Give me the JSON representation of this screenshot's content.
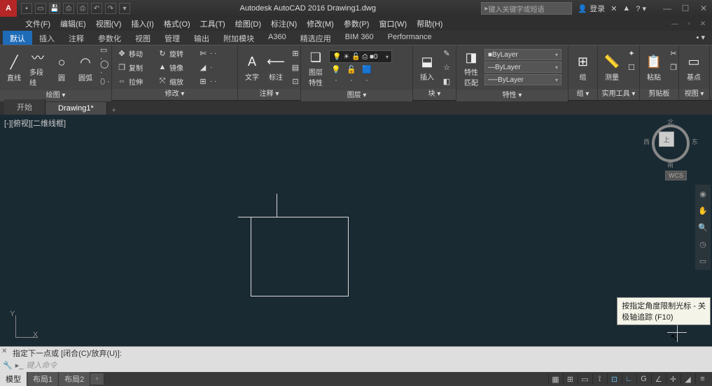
{
  "title": "Autodesk AutoCAD 2016   Drawing1.dwg",
  "search_placeholder": "键入关键字或短语",
  "login_text": "登录",
  "menus": [
    "文件(F)",
    "编辑(E)",
    "视图(V)",
    "插入(I)",
    "格式(O)",
    "工具(T)",
    "绘图(D)",
    "标注(N)",
    "修改(M)",
    "参数(P)",
    "窗口(W)",
    "帮助(H)"
  ],
  "ribbon_tabs": [
    "默认",
    "插入",
    "注释",
    "参数化",
    "视图",
    "管理",
    "输出",
    "附加模块",
    "A360",
    "精选应用",
    "BIM 360",
    "Performance"
  ],
  "ribbon_active": 0,
  "panels": {
    "draw": {
      "title": "绘图 ▾",
      "big": [
        {
          "icon": "╱",
          "label": "直线"
        },
        {
          "icon": "〰",
          "label": "多段线"
        },
        {
          "icon": "○",
          "label": "圆"
        },
        {
          "icon": "◠",
          "label": "圆弧"
        }
      ],
      "small": [
        "▭ ·",
        "◯ ·",
        "⬯ ·"
      ]
    },
    "modify": {
      "title": "修改 ▾",
      "rows": [
        [
          {
            "i": "✥",
            "t": "移动"
          },
          {
            "i": "↻",
            "t": "旋转"
          },
          {
            "i": "✄",
            "t": "· ·"
          }
        ],
        [
          {
            "i": "❐",
            "t": "复制"
          },
          {
            "i": "▲",
            "t": "镜像"
          },
          {
            "i": "◢",
            "t": "·"
          }
        ],
        [
          {
            "i": "⇔",
            "t": "拉伸"
          },
          {
            "i": "⤧",
            "t": "缩放"
          },
          {
            "i": "⊞",
            "t": "· ·"
          }
        ]
      ]
    },
    "annot": {
      "title": "注释 ▾",
      "big": [
        {
          "icon": "A",
          "label": "文字"
        },
        {
          "icon": "⟵",
          "label": "标注"
        }
      ],
      "small": [
        "⊞",
        "▤",
        "⊡"
      ]
    },
    "layer": {
      "title": "图层 ▾",
      "big": [
        {
          "icon": "❏",
          "label": "图层\n特性"
        }
      ],
      "combo": "0",
      "small": [
        "💡",
        "🔓",
        "🟦",
        "·",
        "·",
        "·"
      ]
    },
    "block": {
      "title": "块 ▾",
      "big": [
        {
          "icon": "⬓",
          "label": "插入"
        }
      ],
      "small": [
        "✎",
        "☆",
        "◧"
      ]
    },
    "props": {
      "title": "特性 ▾",
      "big": [
        {
          "icon": "◨",
          "label": "特性\n匹配"
        }
      ],
      "combos": [
        "ByLayer",
        "ByLayer",
        "ByLayer"
      ]
    },
    "group": {
      "title": "组 ▾",
      "big": [
        {
          "icon": "⊞",
          "label": "组"
        }
      ],
      "small": [
        "◫"
      ]
    },
    "util": {
      "title": "实用工具 ▾",
      "big": [
        {
          "icon": "📏",
          "label": "测量"
        }
      ],
      "small": [
        "✦",
        "☐"
      ]
    },
    "clip": {
      "title": "剪贴板",
      "big": [
        {
          "icon": "📋",
          "label": "粘贴"
        }
      ],
      "small": [
        "✂",
        "❐"
      ]
    },
    "view": {
      "title": "视图 ▾",
      "big": [
        {
          "icon": "▭",
          "label": "基点"
        }
      ]
    }
  },
  "file_tabs": [
    {
      "label": "开始",
      "active": false
    },
    {
      "label": "Drawing1*",
      "active": true
    }
  ],
  "viewport_label": "[-][俯视][二维线框]",
  "navcube": {
    "face": "上",
    "n": "北",
    "s": "南",
    "e": "东",
    "w": "西",
    "wcs": "WCS"
  },
  "ucs": {
    "x": "X",
    "y": "Y"
  },
  "tooltip": {
    "line1": "按指定角度限制光标 - 关",
    "line2": "极轴追踪 (F10)"
  },
  "cmd_history": "指定下一点或 [闭合(C)/放弃(U)]:",
  "cmd_placeholder": "键入命令",
  "model_tabs": [
    {
      "label": "模型",
      "active": true
    },
    {
      "label": "布局1",
      "active": false
    },
    {
      "label": "布局2",
      "active": false
    }
  ],
  "status_icons": [
    "▦",
    "⊞",
    "▭",
    "⟟",
    "⊡",
    "∟",
    "G",
    "∠",
    "✛",
    "◢",
    "≡"
  ]
}
